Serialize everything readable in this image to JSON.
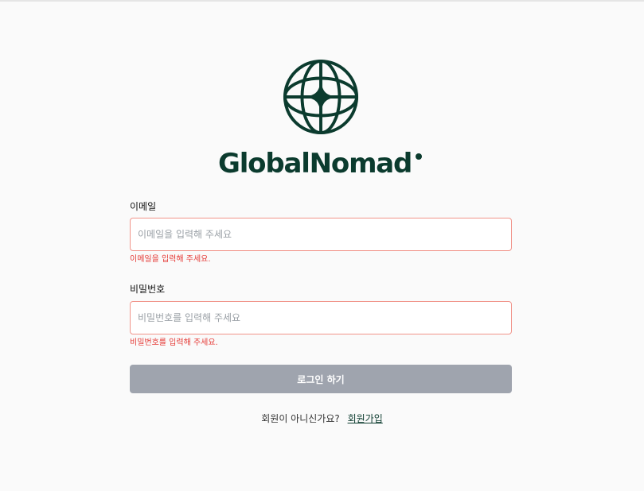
{
  "brand": {
    "name": "GlobalNomad",
    "color": "#0b3b2e"
  },
  "form": {
    "email": {
      "label": "이메일",
      "placeholder": "이메일을 입력해 주세요",
      "value": "",
      "error": "이메일을 입력해 주세요."
    },
    "password": {
      "label": "비밀번호",
      "placeholder": "비밀번호를 입력해 주세요",
      "value": "",
      "error": "비밀번호를 입력해 주세요."
    },
    "submit_label": "로그인 하기",
    "error_color": "#e53935",
    "disabled_button_color": "#9fa4ae"
  },
  "signup": {
    "prompt": "회원이 아니신가요?",
    "link_label": "회원가입"
  }
}
